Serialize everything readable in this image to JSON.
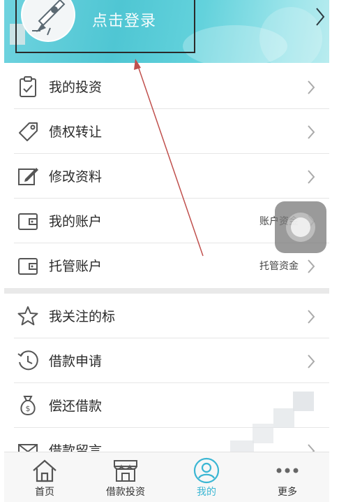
{
  "header": {
    "login_label": "点击登录",
    "chevron_icon": "chevron-right-icon",
    "gradient_color": "#56c9d6"
  },
  "section1": {
    "items": [
      {
        "label": "我的投资",
        "icon": "clipboard-check-icon",
        "value": ""
      },
      {
        "label": "债权转让",
        "icon": "price-tag-icon",
        "value": ""
      },
      {
        "label": "修改资料",
        "icon": "edit-pencil-icon",
        "value": ""
      },
      {
        "label": "我的账户",
        "icon": "wallet-icon",
        "value": "账户资金"
      },
      {
        "label": "托管账户",
        "icon": "wallet-icon",
        "value": "托管资金"
      }
    ]
  },
  "section2": {
    "items": [
      {
        "label": "我关注的标",
        "icon": "star-icon",
        "value": ""
      },
      {
        "label": "借款申请",
        "icon": "clock-icon",
        "value": ""
      },
      {
        "label": "偿还借款",
        "icon": "money-bag-icon",
        "value": ""
      },
      {
        "label": "借款留言",
        "icon": "envelope-icon",
        "value": ""
      }
    ]
  },
  "tabbar": {
    "tabs": [
      {
        "label": "首页",
        "icon": "home-icon",
        "active": false
      },
      {
        "label": "借款投资",
        "icon": "storefront-icon",
        "active": false
      },
      {
        "label": "我的",
        "icon": "user-icon",
        "active": true
      },
      {
        "label": "更多",
        "icon": "more-dots-icon",
        "active": false
      }
    ],
    "active_color": "#3bb6d3"
  },
  "annotation": {
    "arrow_color": "#c0504d"
  }
}
